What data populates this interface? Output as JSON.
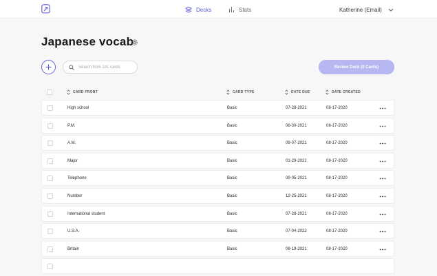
{
  "nav": {
    "decks_label": "Decks",
    "stats_label": "Stats",
    "user_label": "Katherine (Email)"
  },
  "page": {
    "title": "Japanese vocab"
  },
  "toolbar": {
    "search_placeholder": "Search from 191 cards",
    "review_label": "Review Deck (0 Cards)"
  },
  "table": {
    "headers": {
      "front": "CARD FRONT",
      "type": "CARD TYPE",
      "due": "DATE DUE",
      "created": "DATE CREATED"
    },
    "rows": [
      {
        "front": "High school",
        "type": "Basic",
        "due": "07-28-2021",
        "created": "08-17-2020"
      },
      {
        "front": "P.M.",
        "type": "Basic",
        "due": "08-30-2021",
        "created": "08-17-2020"
      },
      {
        "front": "A.M.",
        "type": "Basic",
        "due": "09-07-2021",
        "created": "08-17-2020"
      },
      {
        "front": "Major",
        "type": "Basic",
        "due": "01-29-2022",
        "created": "08-17-2020"
      },
      {
        "front": "Telephone",
        "type": "Basic",
        "due": "09-05-2021",
        "created": "08-17-2020"
      },
      {
        "front": "Number",
        "type": "Basic",
        "due": "12-25-2021",
        "created": "08-17-2020"
      },
      {
        "front": "International student",
        "type": "Basic",
        "due": "07-28-2021",
        "created": "08-17-2020"
      },
      {
        "front": "U.S.A.",
        "type": "Basic",
        "due": "07-04-2022",
        "created": "08-17-2020"
      },
      {
        "front": "Britain",
        "type": "Basic",
        "due": "08-19-2021",
        "created": "08-17-2020"
      }
    ]
  },
  "colors": {
    "accent": "#5b5bd6",
    "review_button": "#b7b7f2",
    "background": "#f7f7f8"
  },
  "icons": {
    "logo": "logo-icon",
    "decks": "stack-icon",
    "stats": "bar-chart-icon",
    "user_menu": "chevron-down-icon",
    "settings": "gear-icon",
    "add": "plus-icon",
    "search": "search-icon",
    "sort": "sort-icon",
    "row_menu": "more-horizontal-icon"
  }
}
